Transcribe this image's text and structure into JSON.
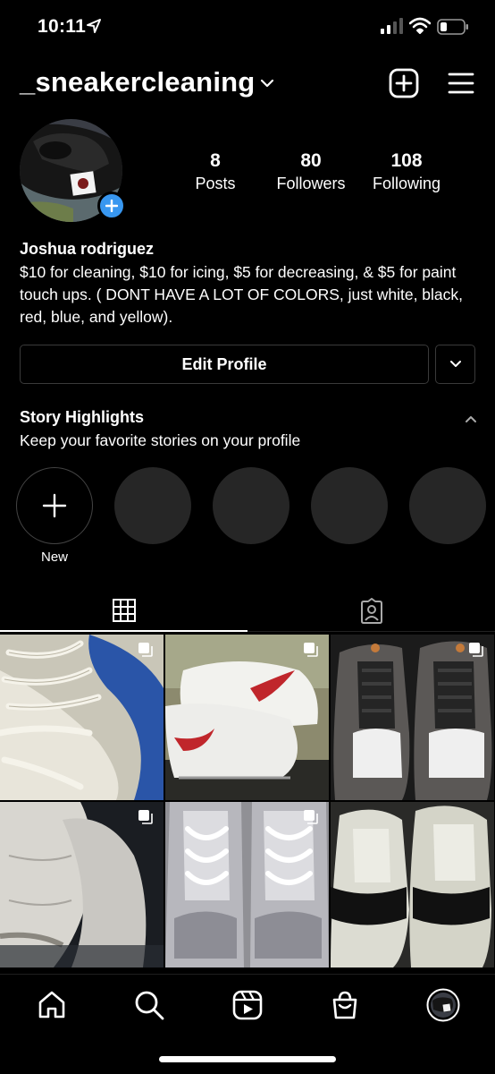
{
  "status_bar": {
    "time": "10:11"
  },
  "header": {
    "username": "_sneakercleaning"
  },
  "stats": [
    {
      "value": "8",
      "label": "Posts"
    },
    {
      "value": "80",
      "label": "Followers"
    },
    {
      "value": "108",
      "label": "Following"
    }
  ],
  "profile": {
    "name": "Joshua rodriguez",
    "bio": "$10 for cleaning, $10 for icing, $5 for decreasing, & $5 for paint touch ups. ( DONT HAVE A LOT OF COLORS, just white, black, red, blue, and yellow)."
  },
  "buttons": {
    "edit_profile": "Edit Profile"
  },
  "highlights": {
    "title": "Story Highlights",
    "subtitle": "Keep your favorite stories on your profile",
    "new_label": "New"
  },
  "icons": {
    "location": "location-arrow-icon",
    "signal": "cellular-signal-icon",
    "wifi": "wifi-icon",
    "battery": "battery-icon",
    "create": "plus-square-icon",
    "menu": "hamburger-menu-icon",
    "grid_tab": "grid-icon",
    "tagged_tab": "tagged-person-icon",
    "nav": [
      "home-icon",
      "search-icon",
      "reels-icon",
      "shop-icon",
      "profile-avatar-icon"
    ]
  },
  "colors": {
    "background": "#000000",
    "accent_blue": "#3897f0",
    "highlight_placeholder": "#262626"
  }
}
